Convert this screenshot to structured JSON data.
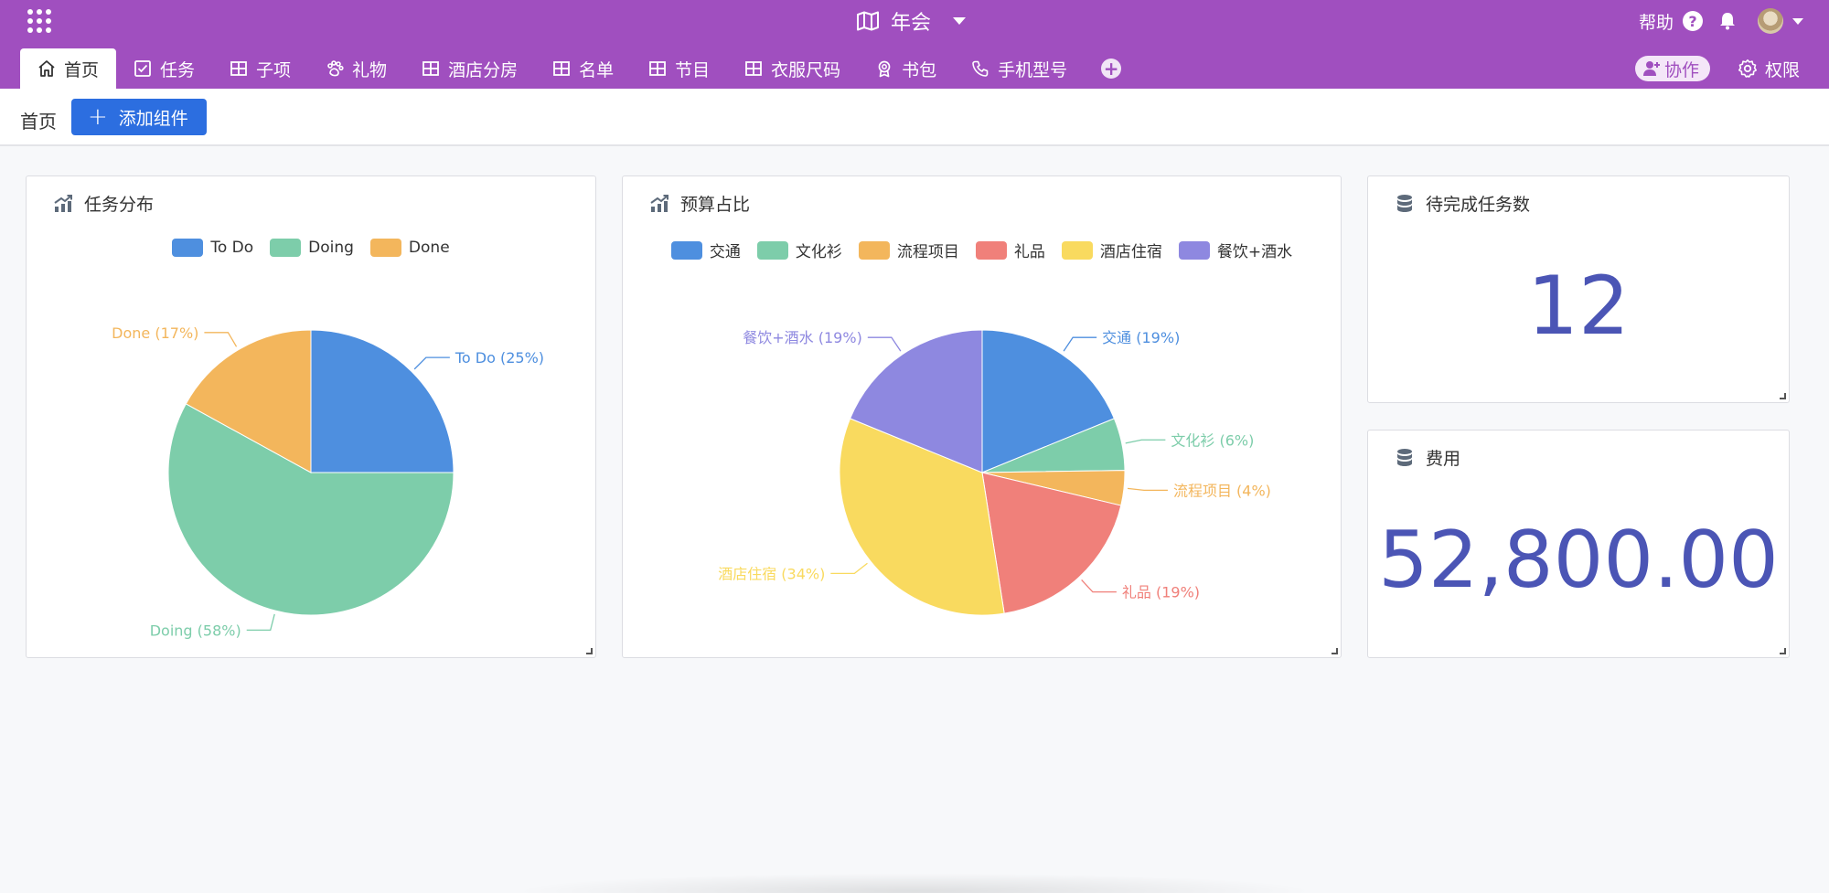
{
  "header": {
    "title": "年会",
    "help_label": "帮助",
    "help_icon_text": "?",
    "colors": {
      "brand": "#a04fbf",
      "accent": "#2c6ee0",
      "number": "#4b55b5"
    }
  },
  "tabs": [
    {
      "label": "首页",
      "icon": "home-icon"
    },
    {
      "label": "任务",
      "icon": "checkbox-icon"
    },
    {
      "label": "子项",
      "icon": "table-icon"
    },
    {
      "label": "礼物",
      "icon": "paw-icon"
    },
    {
      "label": "酒店分房",
      "icon": "table-icon"
    },
    {
      "label": "名单",
      "icon": "table-icon"
    },
    {
      "label": "节目",
      "icon": "table-icon"
    },
    {
      "label": "衣服尺码",
      "icon": "table-icon"
    },
    {
      "label": "书包",
      "icon": "badge-icon"
    },
    {
      "label": "手机型号",
      "icon": "phone-icon"
    }
  ],
  "tab_add_symbol": "+",
  "tabs_right": {
    "collab_label": "协作",
    "perm_label": "权限"
  },
  "toolbar": {
    "breadcrumb": "首页",
    "add_widget_plus": "+",
    "add_widget_label": "添加组件"
  },
  "cards": {
    "task_dist": {
      "title": "任务分布"
    },
    "budget": {
      "title": "预算占比"
    },
    "pending": {
      "title": "待完成任务数",
      "value": "12"
    },
    "cost": {
      "title": "费用",
      "value": "52,800.00"
    }
  },
  "chart_data": [
    {
      "type": "pie",
      "title": "任务分布",
      "categories": [
        "To Do",
        "Doing",
        "Done"
      ],
      "values": [
        25,
        58,
        17
      ],
      "labels": [
        "To Do  (25%)",
        "Doing (58%)",
        "Done (17%)"
      ],
      "colors": [
        "#4e8fdf",
        "#7dcdaa",
        "#f3b65c"
      ],
      "legend": "top"
    },
    {
      "type": "pie",
      "title": "预算占比",
      "categories": [
        "交通",
        "文化衫",
        "流程项目",
        "礼品",
        "酒店住宿",
        "餐饮+酒水"
      ],
      "values": [
        19,
        6,
        4,
        19,
        34,
        19
      ],
      "labels": [
        "交通 (19%)",
        "文化衫 (6%)",
        "流程项目 (4%)",
        "礼品 (19%)",
        "酒店住宿 (34%)",
        "餐饮+酒水 (19%)"
      ],
      "colors": [
        "#4e8fdf",
        "#7dcdaa",
        "#f3b65c",
        "#f0807a",
        "#f9da5f",
        "#8e88e0"
      ],
      "legend": "top"
    }
  ]
}
